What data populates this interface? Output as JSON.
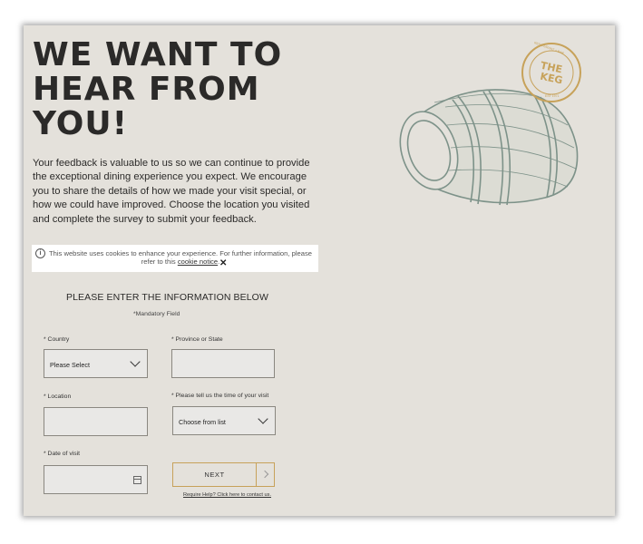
{
  "header": {
    "headline_line1": "WE WANT TO",
    "headline_line2": "HEAR FROM",
    "headline_line3": "YOU!"
  },
  "intro": "Your feedback is valuable to us so we can continue to provide the exceptional dining experience you expect. We encourage you to share the details of how we made your visit special, or how we could have improved. Choose the location you visited and complete the survey to submit your feedback.",
  "logo": {
    "top_text": "RESTAURANT + BAR",
    "name_line1": "THE",
    "name_line2": "KEG",
    "bottom_text": "EST 1971"
  },
  "cookie_banner": {
    "icon": "info-icon",
    "message": "This website uses cookies to enhance your experience. For further information, please refer to this",
    "link_text": "cookie notice",
    "suffix": ".",
    "close_icon": "close-icon"
  },
  "form": {
    "title": "PLEASE ENTER THE INFORMATION BELOW",
    "mandatory_note": "*Mandatory Field",
    "country_label": "* Country",
    "country_value": "Please Select",
    "province_label": "* Province or State",
    "location_label": "* Location",
    "visit_time_label": "* Please tell us the time of your visit",
    "visit_time_value": "Choose from list",
    "date_label": "* Date of visit",
    "next_label": "NEXT",
    "help_link": "Require Help? Click here to contact us."
  },
  "colors": {
    "background": "#e4e1db",
    "text": "#2b2a29",
    "accent_gold": "#c7a25a",
    "barrel_ink": "#7d9289"
  }
}
